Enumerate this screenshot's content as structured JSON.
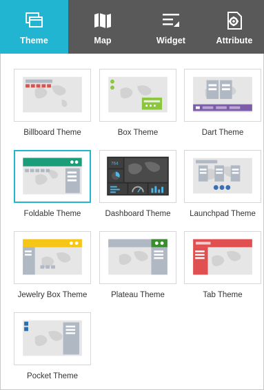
{
  "tabs": [
    {
      "label": "Theme",
      "icon": "theme-icon",
      "active": true
    },
    {
      "label": "Map",
      "icon": "map-icon",
      "active": false
    },
    {
      "label": "Widget",
      "icon": "widget-icon",
      "active": false
    },
    {
      "label": "Attribute",
      "icon": "attribute-icon",
      "active": false
    }
  ],
  "themes": [
    {
      "name": "Billboard Theme"
    },
    {
      "name": "Box Theme"
    },
    {
      "name": "Dart Theme"
    },
    {
      "name": "Foldable Theme",
      "selected": true
    },
    {
      "name": "Dashboard Theme"
    },
    {
      "name": "Launchpad Theme"
    },
    {
      "name": "Jewelry Box Theme"
    },
    {
      "name": "Plateau Theme"
    },
    {
      "name": "Tab Theme"
    },
    {
      "name": "Pocket Theme"
    }
  ],
  "dashboard_thumb_value": "764",
  "colors": {
    "tab_bar": "#595959",
    "tab_active": "#22b5d1",
    "billboard_red": "#d9534f",
    "box_green": "#8cc63f",
    "dart_purple": "#7b5ea7",
    "foldable_green": "#1a9d78",
    "launchpad_blue": "#3a6fb6",
    "jewelry_yellow": "#f5c518",
    "plateau_green": "#3a8c2f",
    "tab_red": "#e05050",
    "pocket_blue": "#2a6db5"
  }
}
